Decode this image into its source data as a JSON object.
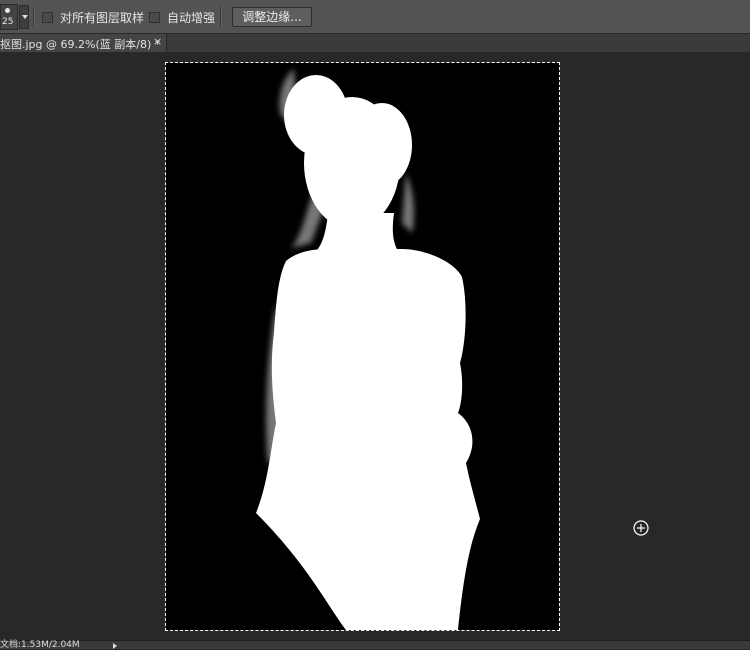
{
  "options_bar": {
    "brush_size": "25",
    "sample_all_layers_label": "对所有图层取样",
    "auto_enhance_label": "自动增强",
    "refine_edge_label": "调整边缘..."
  },
  "document_tab": {
    "title": "抠图.jpg @ 69.2%(蓝 副本/8) *",
    "close_glyph": "×"
  },
  "status_bar": {
    "doc_size": "文档:1.53M/2.04M"
  },
  "colors": {
    "options_bar_bg": "#535353",
    "workspace_bg": "#282828",
    "mask_foreground": "#ffffff",
    "mask_background": "#000000"
  },
  "icons": {
    "brush_preset": "brush-dot-icon",
    "cursor": "crosshair-circle-icon"
  }
}
